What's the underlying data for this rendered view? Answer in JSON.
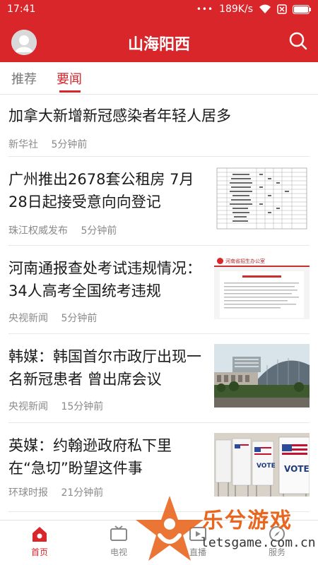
{
  "status_bar": {
    "time": "17:41",
    "dots": "•••",
    "speed": "189K/s"
  },
  "app": {
    "title": "山海阳西"
  },
  "tabs": [
    {
      "label": "推荐",
      "active": false
    },
    {
      "label": "要闻",
      "active": true
    }
  ],
  "news": [
    {
      "title": "加拿大新增新冠感染者年轻人居多",
      "source": "新华社",
      "time": "5分钟前",
      "thumbnail": "none"
    },
    {
      "title_line1": "广州推出2678套公租房 7月",
      "title_line2": "28日起接受意向向登记",
      "source": "珠江权威发布",
      "time": "5分钟前",
      "thumbnail": "document-table"
    },
    {
      "title_line1": "河南通报查处考试违规情况：",
      "title_line2": "34人高考全国统考违规",
      "source": "央视新闻",
      "time": "5分钟前",
      "thumbnail": "government-webpage",
      "thumb_header": "河南省招生办公室"
    },
    {
      "title_line1": "韩媒：韩国首尔市政厅出现一",
      "title_line2": "名新冠患者 曾出席会议",
      "source": "央视新闻",
      "time": "15分钟前",
      "thumbnail": "city-hall-photo"
    },
    {
      "title_line1": "英媒：约翰逊政府私下里",
      "title_line2": "在“急切”盼望这件事",
      "source": "环球时报",
      "time": "21分钟前",
      "thumbnail": "vote-booths-photo",
      "thumb_text": "VOTE"
    }
  ],
  "bottom_nav": [
    {
      "label": "首页",
      "icon": "home-icon",
      "active": true
    },
    {
      "label": "电视",
      "icon": "tv-icon",
      "active": false
    },
    {
      "label": "直播",
      "icon": "live-icon",
      "active": false
    },
    {
      "label": "服务",
      "icon": "compass-icon",
      "active": false
    }
  ],
  "watermark": {
    "brand": "乐兮游戏",
    "url": "letsgame.com.cn"
  },
  "colors": {
    "brand_red": "#d9262a",
    "watermark_orange": "#e9661f"
  }
}
